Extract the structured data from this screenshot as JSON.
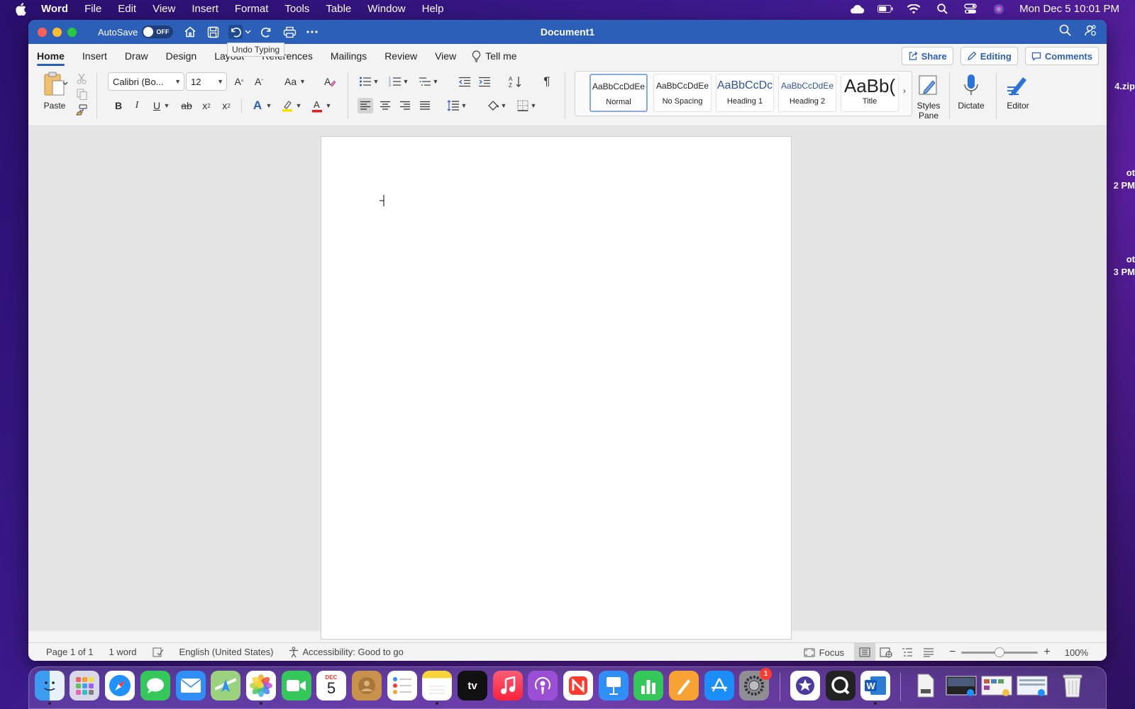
{
  "menubar": {
    "app_name": "Word",
    "items": [
      "File",
      "Edit",
      "View",
      "Insert",
      "Format",
      "Tools",
      "Table",
      "Window",
      "Help"
    ],
    "datetime": "Mon Dec 5  10:01 PM"
  },
  "desktop": {
    "fragments": [
      "4.zip",
      "ot",
      "2 PM",
      "ot",
      "3 PM"
    ]
  },
  "window": {
    "title": "Document1",
    "autosave_label": "AutoSave",
    "autosave_state": "OFF",
    "tooltip": "Undo Typing"
  },
  "ribbon_tabs": {
    "tabs": [
      "Home",
      "Insert",
      "Draw",
      "Design",
      "Layout",
      "References",
      "Mailings",
      "Review",
      "View"
    ],
    "active": "Home",
    "tell_me": "Tell me",
    "share": "Share",
    "editing": "Editing",
    "comments": "Comments"
  },
  "ribbon": {
    "paste_label": "Paste",
    "font_name": "Calibri (Bo...",
    "font_size": "12",
    "change_case": "Aa",
    "styles": [
      {
        "sample": "AaBbCcDdEe",
        "name": "Normal"
      },
      {
        "sample": "AaBbCcDdEe",
        "name": "No Spacing"
      },
      {
        "sample": "AaBbCcDc",
        "name": "Heading 1"
      },
      {
        "sample": "AaBbCcDdEe",
        "name": "Heading 2"
      },
      {
        "sample": "AaBb(",
        "name": "Title"
      }
    ],
    "styles_pane_line1": "Styles",
    "styles_pane_line2": "Pane",
    "dictate": "Dictate",
    "editor": "Editor"
  },
  "statusbar": {
    "page": "Page 1 of 1",
    "words": "1 word",
    "language": "English (United States)",
    "accessibility": "Accessibility: Good to go",
    "focus": "Focus",
    "zoom": "100%",
    "zoom_level_fraction": 0.5
  },
  "dock": {
    "calendar_month": "DEC",
    "calendar_day": "5",
    "settings_badge": "1"
  },
  "colors": {
    "titlebar": "#2b5fb8",
    "accent": "#2b5fb8",
    "highlight_yellow": "#f5e100",
    "font_color_red": "#e02020"
  }
}
